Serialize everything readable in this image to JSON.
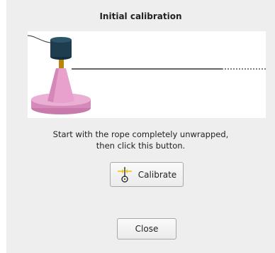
{
  "dialog": {
    "title": "Initial calibration",
    "instructions": {
      "line1": "Start with the rope completely unwrapped,",
      "line2": "then click this button."
    },
    "calibrate_label": "Calibrate",
    "close_label": "Close",
    "icons": {
      "illustration": "winch-spool-on-cone-illustration",
      "calibrate": "calibrate-spool-icon"
    },
    "colors": {
      "cone": "#e8a0cc",
      "spool": "#1e3d4f",
      "shaft": "#b8860b",
      "rope": "#333333",
      "calibrate_icon_accent": "#f5c400",
      "dialog_bg": "#eeeeee"
    }
  }
}
